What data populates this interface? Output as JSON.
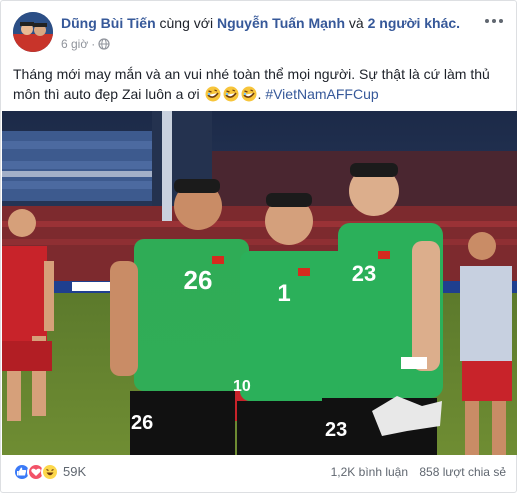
{
  "post": {
    "author": "Dũng Bùi Tiến",
    "with_text": "cùng với",
    "tagged_friend": "Nguyễn Tuấn Mạnh",
    "and_text": "và",
    "others": "2 người khác.",
    "time": "6 giờ",
    "separator": "·",
    "privacy_icon": "globe-icon",
    "message": "Tháng mới may mắn và an vui nhé toàn thể mọi người. Sự thật là cứ làm thủ môn thì auto đẹp Zai luôn a ơi",
    "emojis": [
      "rofl-emoji",
      "rofl-emoji",
      "rofl-emoji"
    ],
    "hashtag": "#VietNamAFFCup",
    "photo_description_icon": "team-photo"
  },
  "footer": {
    "reactions": [
      "like-icon",
      "love-icon",
      "haha-icon"
    ],
    "reaction_count": "59K",
    "comments": "1,2K bình luận",
    "shares": "858 lượt chia sẻ"
  },
  "photo": {
    "jersey_numbers": [
      "26",
      "1",
      "23"
    ],
    "bg_number_left": "10"
  },
  "colors": {
    "link": "#365899",
    "text": "#1d2129",
    "meta": "#90949c",
    "jersey_green": "#2bb05a",
    "like_blue": "#3b7af7",
    "love_red": "#f25268",
    "haha_yellow": "#fcd74b"
  }
}
